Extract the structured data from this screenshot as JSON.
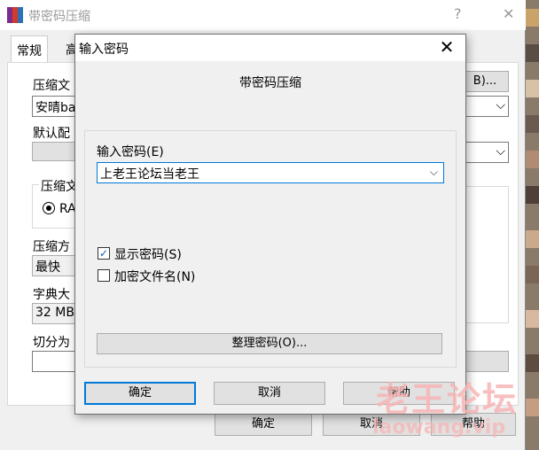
{
  "background_dialog": {
    "title": "带密码压缩",
    "help_glyph": "?",
    "close_glyph": "✕",
    "tabs": [
      "常规",
      "高"
    ],
    "archive_name_label": "压缩文",
    "archive_name_value": "安晴ba",
    "browse_button": "B)...",
    "default_profile_label": "默认配",
    "format_group_label": "压缩文",
    "format_radio_label": "RA",
    "method_label": "压缩方",
    "method_value": "最快",
    "dict_label": "字典大",
    "dict_value": "32 MB",
    "split_label": "切分为",
    "ok_button": "确定",
    "cancel_button": "取消",
    "help_button": "帮助"
  },
  "dialog": {
    "title": "输入密码",
    "close_glyph": "✕",
    "subtitle": "带密码压缩",
    "password_label": "输入密码(E)",
    "password_value": "上老王论坛当老王",
    "chevron": "⌵",
    "show_password_label": "显示密码(S)",
    "show_password_checked": true,
    "encrypt_filenames_label": "加密文件名(N)",
    "encrypt_filenames_checked": false,
    "organize_button": "整理密码(O)...",
    "ok_button": "确定",
    "cancel_button": "取消",
    "help_button": "帮助"
  },
  "watermark": {
    "text": "老王论坛",
    "url": "laowang.vip"
  },
  "colors": {
    "accent": "#0078d7",
    "check": "#0a5bc4",
    "watermark": "#f7b5b5"
  }
}
